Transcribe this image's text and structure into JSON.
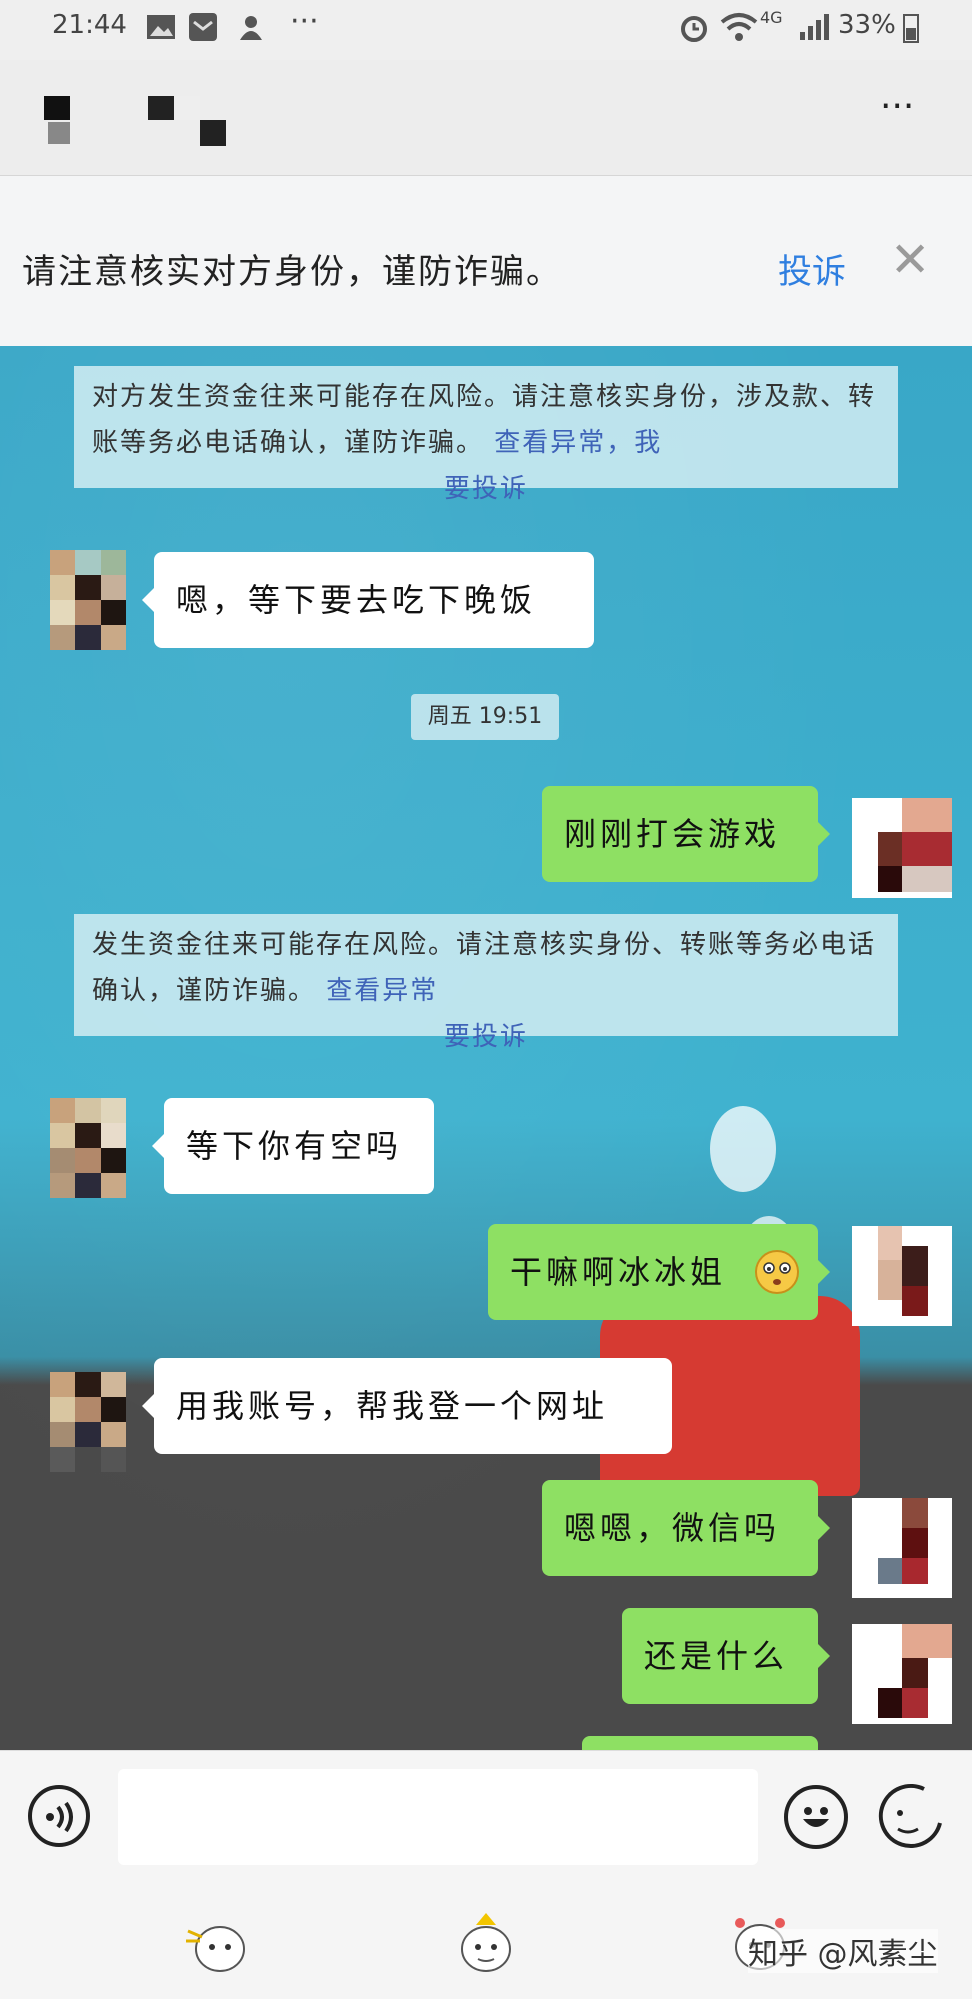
{
  "status_bar": {
    "time": "21:44",
    "more": "···",
    "network": "4G",
    "battery": "33%"
  },
  "header": {
    "menu_label": "···"
  },
  "banner": {
    "text": "请注意核实对方身份，谨防诈骗。",
    "complaint_link": "投诉",
    "close_label": "✕"
  },
  "chat": {
    "notice1": {
      "text": "对方发生资金往来可能存在风险。请注意核实身份，涉及款、转账等务必电话确认，谨防诈骗。",
      "link": "查看异常，我",
      "link2": "要投诉"
    },
    "msg1": "嗯，等下要去吃下晚饭",
    "timestamp": "周五 19:51",
    "msg2": "刚刚打会游戏",
    "notice2": {
      "text": "发生资金往来可能存在风险。请注意核实身份、转账等务必电话确认，谨防诈骗。",
      "link": "查看异常",
      "link2": "要投诉"
    },
    "msg3": "等下你有空吗",
    "msg4": "干嘛啊冰冰姐",
    "msg5": "用我账号，帮我登一个网址",
    "msg6": "嗯嗯，微信吗",
    "msg7": "还是什么"
  },
  "input_bar": {
    "watermark": "知乎 @风素尘"
  },
  "colors": {
    "out_bubble": "#8ee063",
    "in_bubble": "#ffffff",
    "link": "#2f7fe0",
    "chat_bg": "#3aa9c9"
  }
}
